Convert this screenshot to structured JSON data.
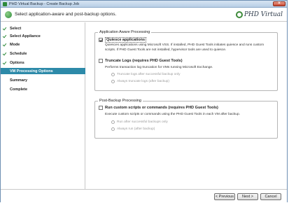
{
  "window": {
    "title": "PHD Virtual Backup - Create Backup Job"
  },
  "header": {
    "instruction": "Select application-aware and post-backup options.",
    "logo_text": "PHD Virtual"
  },
  "sidebar": {
    "steps": [
      {
        "label": "Select",
        "done": true
      },
      {
        "label": "Select Appliance",
        "done": true
      },
      {
        "label": "Mode",
        "done": true
      },
      {
        "label": "Schedule",
        "done": true
      },
      {
        "label": "Options",
        "done": true
      },
      {
        "label": "VM Processing Options",
        "done": false,
        "active": true
      },
      {
        "label": "Summary",
        "done": false
      },
      {
        "label": "Complete",
        "done": false
      }
    ]
  },
  "app_aware": {
    "legend": "Application Aware Processing",
    "quiesce": {
      "label": "Quiesce applications",
      "checked": true,
      "description": "Quiesces applications using Microsoft VSS. If installed, PHD Guest Tools initiates quiesce and runs custom scripts. If PHD Guest Tools are not installed, hypervisor tools are used to quiesce."
    },
    "truncate": {
      "label": "Truncate Logs (requires PHD Guest Tools)",
      "checked": false,
      "description": "Performs transaction log truncation for VMs running Microsoft Exchange.",
      "options": [
        "Truncate logs after successful backup only",
        "Always truncate logs (after backup)"
      ]
    }
  },
  "post_backup": {
    "legend": "Post-Backup Processing",
    "scripts": {
      "label": "Run custom scripts or commands (requires PHD Guest Tools)",
      "checked": false,
      "description": "Execute custom scripts or commands using the PHD Guest Tools in each VM after backup.",
      "options": [
        "Run after successful backups only",
        "Always run (after backup)"
      ]
    }
  },
  "footer": {
    "previous": "< Previous",
    "next": "Next >",
    "cancel": "Cancel"
  }
}
